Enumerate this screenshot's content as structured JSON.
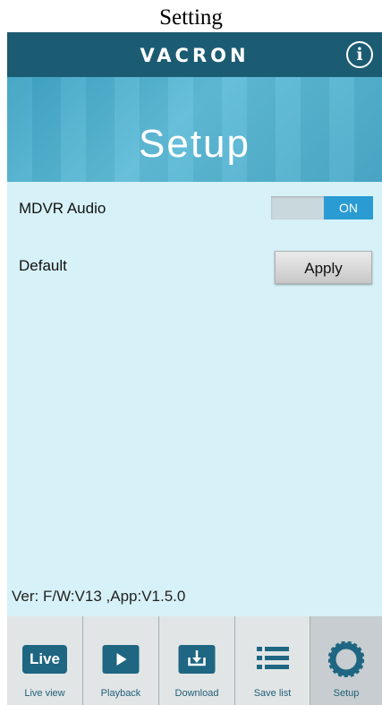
{
  "page_caption": "Setting",
  "header": {
    "brand": "VACRON",
    "info_icon": "info-icon"
  },
  "banner": {
    "title": "Setup"
  },
  "settings": {
    "audio": {
      "label": "MDVR Audio",
      "toggle_state": "ON"
    },
    "default": {
      "label": "Default",
      "button_label": "Apply"
    }
  },
  "version_text": "Ver: F/W:V13 ,App:V1.5.0",
  "tabs": [
    {
      "label": "Live view",
      "icon": "live-icon",
      "icon_text": "Live"
    },
    {
      "label": "Playback",
      "icon": "play-icon"
    },
    {
      "label": "Download",
      "icon": "download-icon"
    },
    {
      "label": "Save list",
      "icon": "list-icon"
    },
    {
      "label": "Setup",
      "icon": "gear-icon",
      "active": true
    }
  ],
  "colors": {
    "topbar": "#1c5c73",
    "accent": "#2a9bd3",
    "background": "#d6f1f7"
  }
}
